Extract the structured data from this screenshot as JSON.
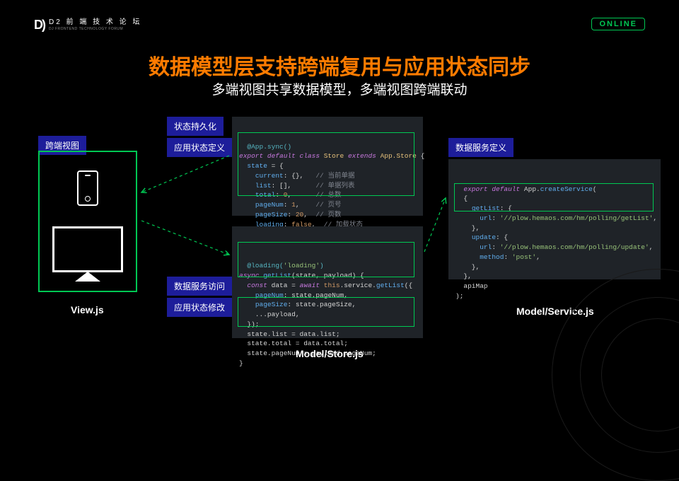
{
  "header": {
    "logo_icon": "D)",
    "logo_cn": "D2 前 端 技 术 论 坛",
    "logo_en": "DJ FRONTEND TECHNOLOGY FORUM",
    "online_badge": "ONLINE"
  },
  "title": "数据模型层支持跨端复用与应用状态同步",
  "subtitle": "多端视图共享数据模型，多端视图跨端联动",
  "tags": {
    "cross_view": "跨端视图",
    "state_persist": "状态持久化",
    "app_state_def": "应用状态定义",
    "data_service_access": "数据服务访问",
    "app_state_modify": "应用状态修改",
    "data_service_def": "数据服务定义"
  },
  "captions": {
    "view": "View.js",
    "store": "Model/Store.js",
    "service": "Model/Service.js"
  },
  "code": {
    "store_top": "@App.sync()\nexport default class Store extends App.Store {\n  state = {\n    current: {},   // 当前单据\n    list: [],      // 单据列表\n    total: 0,      // 总数\n    pageNum: 1,    // 页号\n    pageSize: 20,  // 页数\n    loading: false,  // 加载状态\n  }",
    "store_bottom": "@loading('loading')\nasync getList(state, payload) {\n  const data = await this.service.getList({\n    pageNum: state.pageNum,\n    pageSize: state.pageSize,\n    ...payload,\n  });\n  state.list = data.list;\n  state.total = data.total;\n  state.pageNum = payload.pageNum;\n}",
    "service": "export default App.createService(\n  {\n    getList: {\n      url: '//plow.hemaos.com/hm/polling/getList',\n    },\n    update: {\n      url: '//plow.hemaos.com/hm/polling/update',\n      method: 'post',\n    },\n  },\n  apiMap\n);"
  }
}
